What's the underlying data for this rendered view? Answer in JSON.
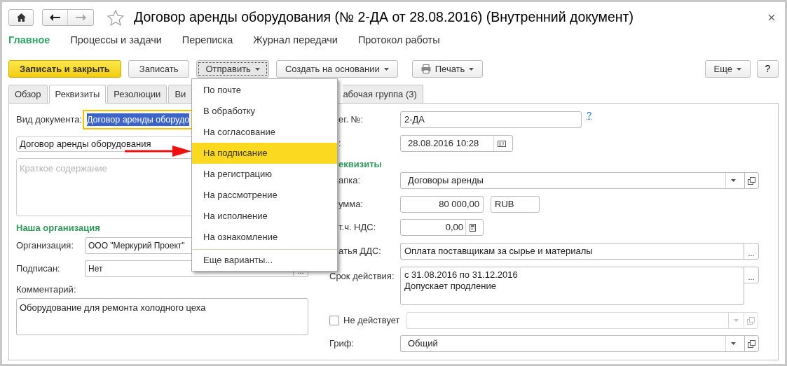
{
  "window": {
    "title": "Договор аренды оборудования (№ 2-ДА от 28.08.2016) (Внутренний документ)"
  },
  "nav": [
    {
      "label": "Главное",
      "selected": true
    },
    {
      "label": "Процессы и задачи",
      "selected": false
    },
    {
      "label": "Переписка",
      "selected": false
    },
    {
      "label": "Журнал передачи",
      "selected": false
    },
    {
      "label": "Протокол работы",
      "selected": false
    }
  ],
  "toolbar": [
    {
      "label": "Записать и закрыть",
      "kind": "primary",
      "pressed": false
    },
    {
      "label": "Записать",
      "kind": "plain",
      "pressed": false
    },
    {
      "label": "Отправить",
      "kind": "dropdown",
      "pressed": true
    },
    {
      "label": "Создать на основании",
      "kind": "dropdown",
      "pressed": false
    },
    {
      "label": "Печать",
      "kind": "print",
      "pressed": false
    }
  ],
  "toolbar_right": [
    {
      "label": "Еще",
      "kind": "dropdown"
    },
    {
      "label": "?",
      "kind": "plain"
    }
  ],
  "tabs": [
    {
      "label": "Обзор",
      "selected": false
    },
    {
      "label": "Реквизиты",
      "selected": true
    },
    {
      "label": "Резолюции",
      "selected": false
    },
    {
      "label": "Ви",
      "selected": false
    }
  ],
  "tabs_after_menu": [
    {
      "label": "абочая группа (3)",
      "selected": false
    }
  ],
  "send_menu": {
    "items": [
      {
        "label": "По почте",
        "selected": false
      },
      {
        "label": "В обработку",
        "selected": false
      },
      {
        "label": "На согласование",
        "selected": false
      },
      {
        "label": "На подписание",
        "selected": true
      },
      {
        "label": "На регистрацию",
        "selected": false
      },
      {
        "label": "На рассмотрение",
        "selected": false
      },
      {
        "label": "На исполнение",
        "selected": false
      },
      {
        "label": "На ознакомление",
        "selected": false
      }
    ],
    "more": "Еще варианты..."
  },
  "left_fields": [
    {
      "kind": "focused",
      "label": "Вид документа:",
      "value": "Договор аренды оборудо"
    },
    {
      "kind": "text",
      "value": "Договор аренды оборудования"
    },
    {
      "kind": "textarea",
      "placeholder": "Краткое содержание"
    },
    {
      "kind": "section",
      "label": "Наша организация"
    },
    {
      "kind": "choice",
      "label": "Организация:",
      "value": "ООО \"Меркурий Проект\""
    },
    {
      "kind": "choice",
      "label": "Подписан:",
      "value": "Нет",
      "button": "..."
    },
    {
      "kind": "label",
      "label": "Комментарий:"
    },
    {
      "kind": "comment",
      "value": "Оборудование для ремонта холодного цеха"
    }
  ],
  "right_fields": [
    {
      "kind": "text",
      "label": "ег. №:",
      "clipped": true,
      "value": "2-ДА",
      "help": "?"
    },
    {
      "kind": "date",
      "label": ":",
      "clipped": true,
      "value": "28.08.2016 10:28"
    },
    {
      "kind": "section",
      "label": "еквизиты",
      "clipped": true
    },
    {
      "kind": "select",
      "label": "апка:",
      "clipped": true,
      "value": "Договоры аренды"
    },
    {
      "kind": "amount",
      "label": "умма:",
      "clipped": true,
      "value": "80 000,00",
      "currency": "RUB"
    },
    {
      "kind": "calc",
      "label": "т.ч. НДС:",
      "clipped": true,
      "value": "0,00"
    },
    {
      "kind": "choice",
      "label": "атья ДДС:",
      "clipped": true,
      "value": "Оплата поставщикам за сырье и материалы",
      "button": "..."
    },
    {
      "kind": "textarea",
      "label": "Срок действия:",
      "lines": [
        "с 31.08.2016 по 31.12.2016",
        "Допускает продление"
      ],
      "button": "..."
    },
    {
      "kind": "checkbox",
      "label": "Не действует",
      "checked": false
    },
    {
      "kind": "select",
      "label": "Гриф:",
      "value": "Общий"
    }
  ]
}
